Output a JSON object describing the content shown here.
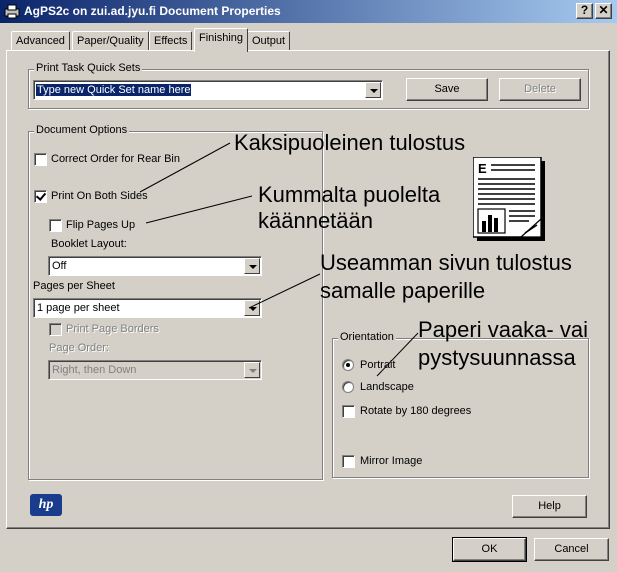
{
  "window": {
    "title": "AgPS2c on zui.ad.jyu.fi Document Properties",
    "help_btn": "?",
    "close_btn": "✕"
  },
  "tabs": [
    {
      "label": "Advanced"
    },
    {
      "label": "Paper/Quality"
    },
    {
      "label": "Effects"
    },
    {
      "label": "Finishing"
    },
    {
      "label": "Output"
    }
  ],
  "quick_sets": {
    "group_label": "Print Task Quick Sets",
    "value": "Type new Quick Set name here",
    "save": "Save",
    "delete": "Delete"
  },
  "document_options": {
    "group_label": "Document Options",
    "correct_order": "Correct Order for Rear Bin",
    "print_both_sides": "Print On Both Sides",
    "flip_pages_up": "Flip Pages Up",
    "booklet_layout_label": "Booklet Layout:",
    "booklet_layout_value": "Off",
    "pages_per_sheet_label": "Pages per Sheet",
    "pages_per_sheet_value": "1 page per sheet",
    "print_page_borders": "Print Page Borders",
    "page_order_label": "Page Order:",
    "page_order_value": "Right, then Down"
  },
  "orientation": {
    "group_label": "Orientation",
    "portrait": "Portrait",
    "landscape": "Landscape",
    "rotate": "Rotate by 180 degrees",
    "mirror": "Mirror Image"
  },
  "annotations": {
    "a1": "Kaksipuoleinen tulostus",
    "a2_l1": "Kummalta puolelta",
    "a2_l2": "käännetään",
    "a3_l1": "Useamman sivun tulostus",
    "a3_l2": "samalle paperille",
    "a4_l1": "Paperi vaaka- vai",
    "a4_l2": "pystysuunnassa"
  },
  "footer": {
    "help": "Help",
    "ok": "OK",
    "cancel": "Cancel",
    "logo": "hp"
  }
}
